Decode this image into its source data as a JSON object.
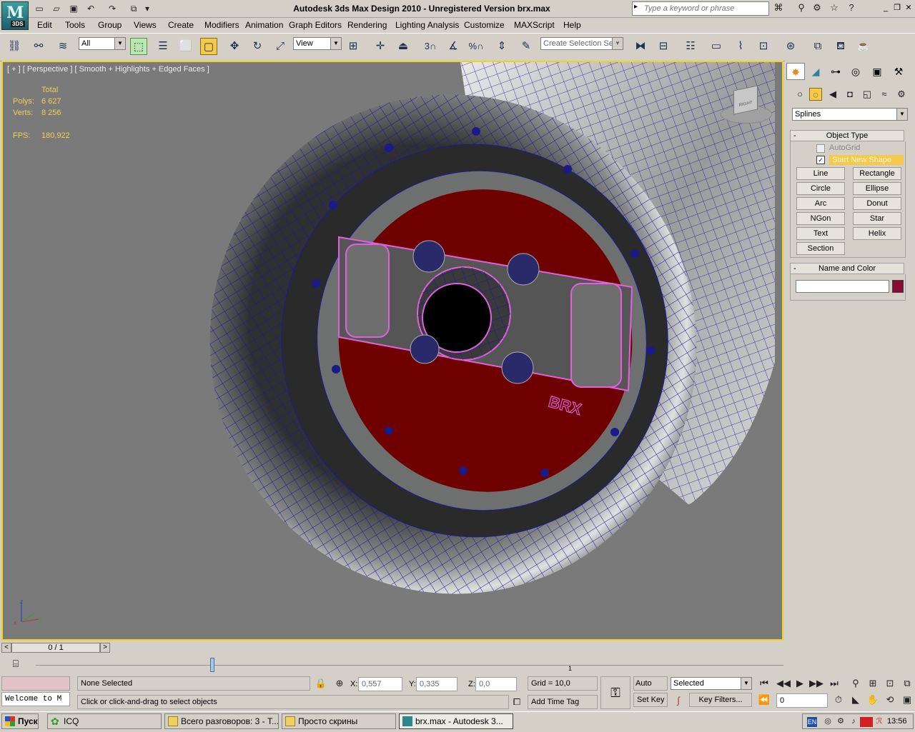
{
  "window": {
    "title": "Autodesk 3ds Max Design 2010    -    Unregistered Version    brx.max",
    "logo_letter": "M",
    "logo_sub": "3DS"
  },
  "search": {
    "placeholder": "Type a keyword or phrase"
  },
  "menu": [
    "Edit",
    "Tools",
    "Group",
    "Views",
    "Create",
    "Modifiers",
    "Animation",
    "Graph Editors",
    "Rendering",
    "Lighting Analysis",
    "Customize",
    "MAXScript",
    "Help"
  ],
  "toolbar": {
    "selection_filter": "All",
    "reference_coord": "View",
    "named_selection": "Create Selection Se",
    "snap_3": "3",
    "snap_pct": "%"
  },
  "viewport": {
    "label": "[ + ] [ Perspective ] [ Smooth + Highlights + Edged Faces ]",
    "stats": {
      "total_label": "Total",
      "polys_label": "Polys:",
      "polys_value": "6 627",
      "verts_label": "Verts:",
      "verts_value": "8 256",
      "fps_label": "FPS:",
      "fps_value": "180,922"
    },
    "viewcube_face": "RIGHT",
    "logo_text": "BRX",
    "axis": {
      "z": "z",
      "x": "x",
      "y": "y"
    }
  },
  "command_panel": {
    "category": "Splines",
    "object_type_title": "Object Type",
    "autogrid_label": "AutoGrid",
    "start_new_shape_label": "Start New Shape",
    "start_new_shape_checked": true,
    "buttons": [
      "Line",
      "Rectangle",
      "Circle",
      "Ellipse",
      "Arc",
      "Donut",
      "NGon",
      "Star",
      "Text",
      "Helix",
      "Section"
    ],
    "name_color_title": "Name and Color",
    "object_color": "#8b0a32"
  },
  "time": {
    "slider_label": "0 / 1",
    "track_tick": "1"
  },
  "status": {
    "selection": "None Selected",
    "prompt": "Click or click-and-drag to select objects",
    "x_label": "X:",
    "x_value": "0,557",
    "y_label": "Y:",
    "y_value": "0,335",
    "z_label": "Z:",
    "z_value": "0,0",
    "grid": "Grid = 10,0",
    "add_time_tag": "Add Time Tag",
    "auto_key": "Auto Key",
    "set_key": "Set Key",
    "key_mode": "Selected",
    "key_filters": "Key Filters...",
    "current_frame": "0",
    "maxscript_listener": "Welcome to M"
  },
  "taskbar": {
    "start": "Пуск",
    "tasks": [
      "ICQ",
      "Всего разговоров: 3 - T...",
      "Просто скрины",
      "brx.max - Autodesk 3..."
    ],
    "lang": "EN",
    "clock": "13:56"
  }
}
